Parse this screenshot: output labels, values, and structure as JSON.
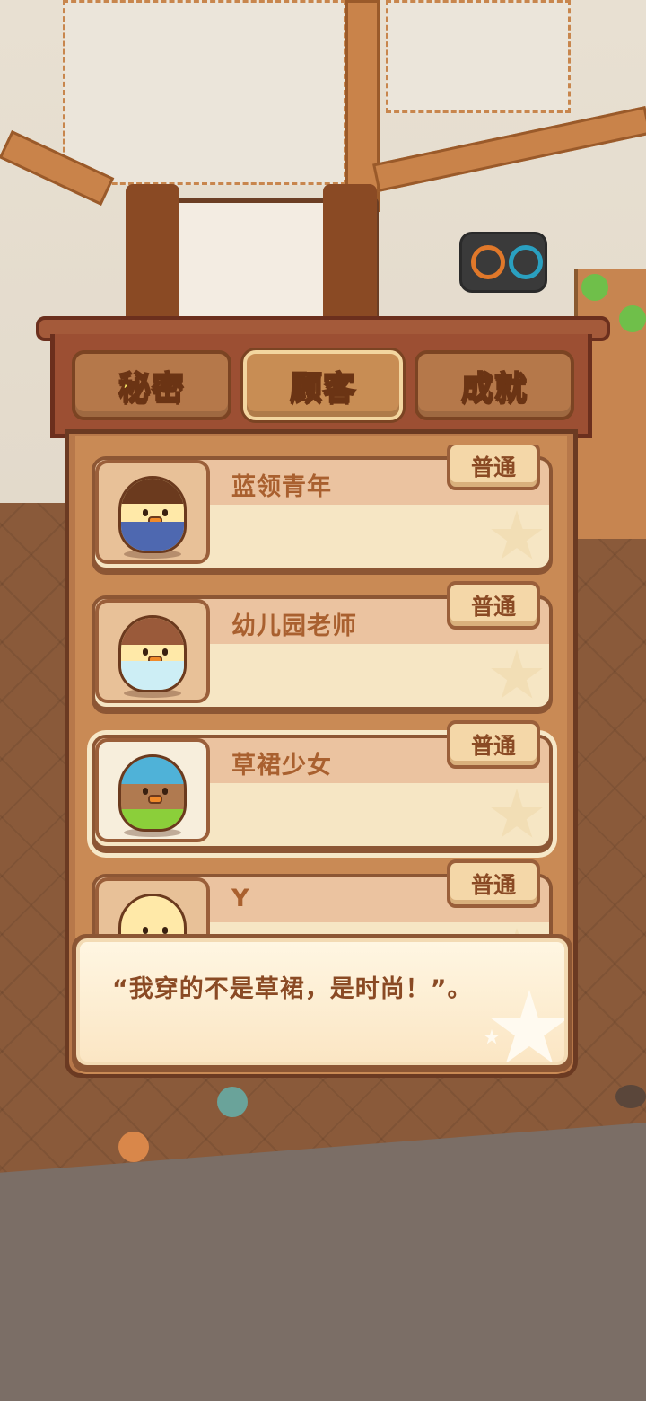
{
  "tabs": [
    {
      "label": "秘密",
      "active": false
    },
    {
      "label": "顾客",
      "active": true
    },
    {
      "label": "成就",
      "active": false
    }
  ],
  "customers": [
    {
      "name": "蓝领青年",
      "rarity": "普通",
      "portrait": "blue-collar-chick-portrait-icon",
      "selected": false
    },
    {
      "name": "幼儿园老师",
      "rarity": "普通",
      "portrait": "teacher-chick-portrait-icon",
      "selected": false
    },
    {
      "name": "草裙少女",
      "rarity": "普通",
      "portrait": "grass-skirt-chick-portrait-icon",
      "selected": true
    },
    {
      "name": "Y",
      "rarity": "普通",
      "portrait": "chick-portrait-icon",
      "selected": false
    }
  ],
  "dialog": {
    "quote": "“我穿的不是草裙，是时尚！”。"
  },
  "colors": {
    "tab_text": "#fff36a",
    "panel_wood": "#9c4f33",
    "card_face": "#f6e6c4",
    "name_text": "#a9602f"
  }
}
